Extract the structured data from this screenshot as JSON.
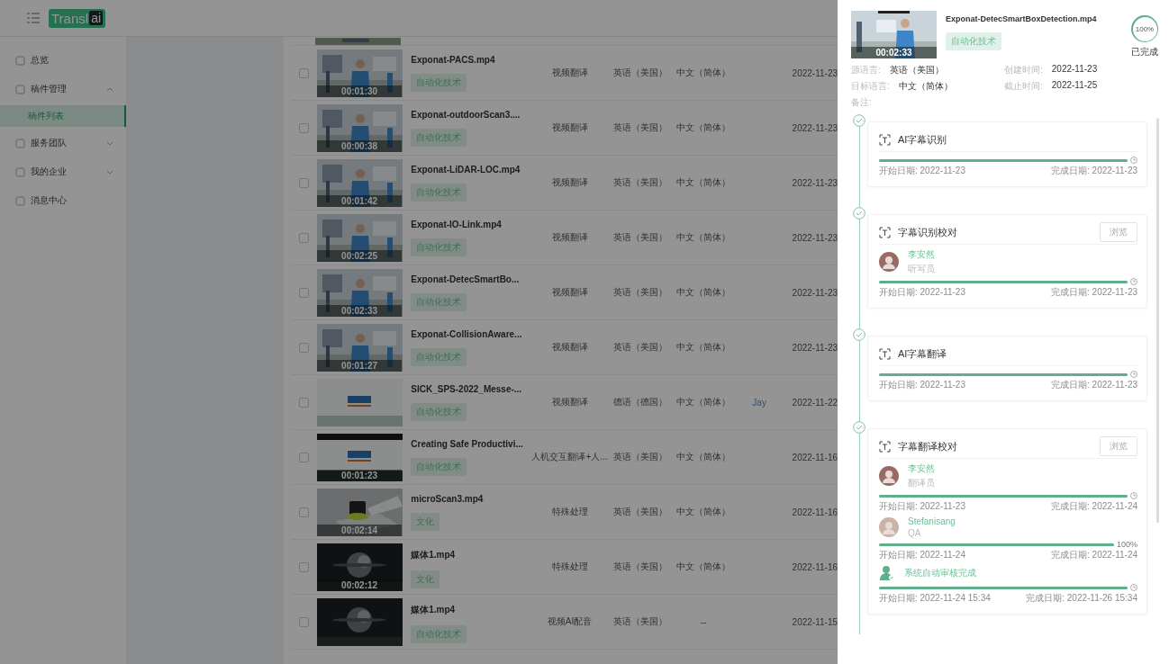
{
  "logo": {
    "text": "Transl",
    "badge": "ai"
  },
  "sidebar": {
    "items": [
      {
        "label": "总览"
      },
      {
        "label": "稿件管理",
        "expanded": true,
        "children": [
          {
            "label": "稿件列表",
            "selected": true
          }
        ]
      },
      {
        "label": "服务团队",
        "expanded": false
      },
      {
        "label": "我的企业",
        "expanded": false
      },
      {
        "label": "消息中心"
      }
    ]
  },
  "table": {
    "rows": [
      {
        "checked": false,
        "duration": "00:01:30",
        "name": "Exponat-PACS.mp4",
        "tag": "自动化技术",
        "type": "视频翻译",
        "source": "英语（美国）",
        "target": "中文（简体）",
        "date": "2022-11-23"
      },
      {
        "checked": false,
        "duration": "00:00:38",
        "name": "Exponat-outdoorScan3....",
        "tag": "自动化技术",
        "type": "视频翻译",
        "source": "英语（美国）",
        "target": "中文（简体）",
        "date": "2022-11-23"
      },
      {
        "checked": false,
        "duration": "00:01:42",
        "name": "Exponat-LiDAR-LOC.mp4",
        "tag": "自动化技术",
        "type": "视频翻译",
        "source": "英语（美国）",
        "target": "中文（简体）",
        "date": "2022-11-23"
      },
      {
        "checked": false,
        "duration": "00:02:25",
        "name": "Exponat-IO-Link.mp4",
        "tag": "自动化技术",
        "type": "视频翻译",
        "source": "英语（美国）",
        "target": "中文（简体）",
        "date": "2022-11-23"
      },
      {
        "checked": false,
        "duration": "00:02:33",
        "name": "Exponat-DetecSmartBo...",
        "tag": "自动化技术",
        "type": "视频翻译",
        "source": "英语（美国）",
        "target": "中文（简体）",
        "date": "2022-11-23"
      },
      {
        "checked": false,
        "duration": "00:01:27",
        "name": "Exponat-CollisionAware...",
        "tag": "自动化技术",
        "type": "视频翻译",
        "source": "英语（美国）",
        "target": "中文（简体）",
        "date": "2022-11-23"
      },
      {
        "checked": false,
        "name": "SICK_SPS-2022_Messe-...",
        "tag": "自动化技术",
        "type": "视频翻译",
        "source": "德语（德国）",
        "target": "中文（简体）",
        "owner": "Jay",
        "date": "2022-11-22"
      },
      {
        "checked": false,
        "duration": "00:01:23",
        "name": "Creating Safe Productivi...",
        "tag": "自动化技术",
        "type": "人机交互翻译+人...",
        "source": "英语（美国）",
        "target": "中文（简体）",
        "date": "2022-11-16"
      },
      {
        "checked": false,
        "duration": "00:02:14",
        "name": "microScan3.mp4",
        "tag": "文化",
        "type": "特殊处理",
        "source": "英语（美国）",
        "target": "中文（简体）",
        "date": "2022-11-16"
      },
      {
        "checked": false,
        "duration": "00:02:12",
        "name": "媒体1.mp4",
        "tag": "文化",
        "type": "特殊处理",
        "source": "英语（美国）",
        "target": "中文（简体）",
        "date": "2022-11-16"
      },
      {
        "checked": false,
        "name": "媒体1.mp4",
        "tag": "自动化技术",
        "type": "视频AI配音",
        "source": "英语（美国）",
        "target": "--",
        "date": "2022-11-15"
      }
    ]
  },
  "drawer": {
    "duration": "00:02:33",
    "title": "Exponat-DetecSmartBoxDetection.mp4",
    "tag": "自动化技术",
    "progress": {
      "level": 1,
      "reading": "100%"
    },
    "status": "已完成",
    "meta": [
      {
        "label": "源语言:",
        "value": "英语（美国）"
      },
      {
        "label": "创建时间:",
        "value": "2022-11-23"
      },
      {
        "label": "目标语言:",
        "value": "中文（简体）"
      },
      {
        "label": "截止时间:",
        "value": "2022-11-25"
      },
      {
        "label": "备注:"
      }
    ],
    "steps": [
      {
        "done": true,
        "title": "AI字幕识别",
        "entries": [
          {
            "kind": "none",
            "level": 1,
            "start": "开始日期: 2022-11-23",
            "end": "完成日期: 2022-11-23"
          }
        ]
      },
      {
        "done": true,
        "title": "字幕识别校对",
        "button": "浏览",
        "entries": [
          {
            "kind": "person",
            "name": "李安然",
            "role": "听写员",
            "level": 1,
            "start": "开始日期: 2022-11-23",
            "end": "完成日期: 2022-11-23"
          }
        ]
      },
      {
        "done": true,
        "title": "AI字幕翻译",
        "entries": [
          {
            "kind": "none",
            "level": 1,
            "start": "开始日期: 2022-11-23",
            "end": "完成日期: 2022-11-23"
          }
        ]
      },
      {
        "done": true,
        "title": "字幕翻译校对",
        "button": "浏览",
        "entries": [
          {
            "kind": "person",
            "name": "李安然",
            "role": "翻译员",
            "level": 1,
            "start": "开始日期: 2022-11-23",
            "end": "完成日期: 2022-11-24"
          },
          {
            "kind": "person",
            "name": "Stefanisang",
            "role": "QA",
            "level": 1,
            "reading": "100%",
            "start": "开始日期: 2022-11-24",
            "end": "完成日期: 2022-11-24"
          },
          {
            "kind": "system",
            "name": "系统自动审核完成",
            "level": 1,
            "start": "开始日期: 2022-11-24 15:34",
            "end": "完成日期: 2022-11-26 15:34"
          }
        ]
      }
    ]
  }
}
